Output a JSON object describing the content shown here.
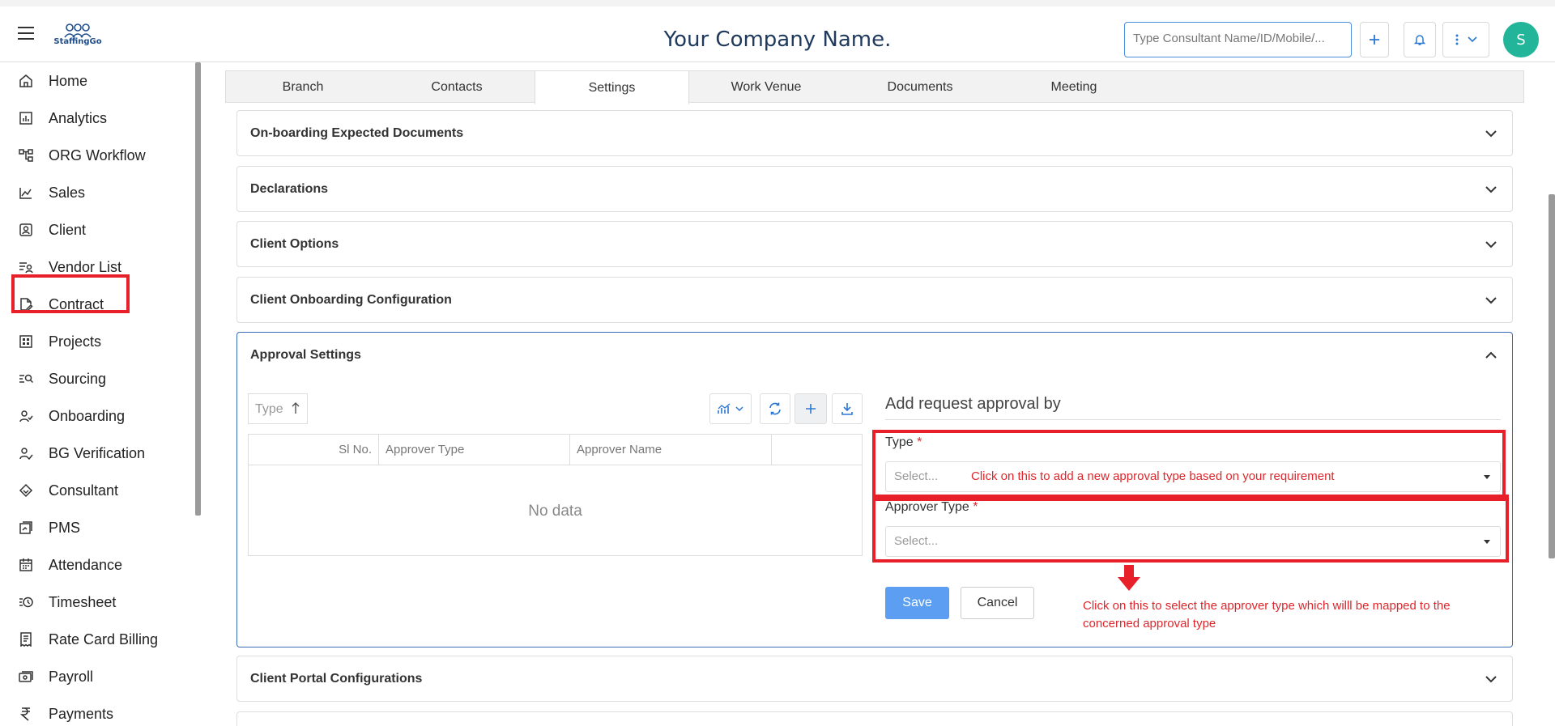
{
  "header": {
    "company_name": "Your Company Name.",
    "logo_text": "StaffingGo",
    "search_placeholder": "Type Consultant Name/ID/Mobile/...",
    "avatar_letter": "S"
  },
  "sidebar": {
    "items": [
      {
        "label": "Home",
        "icon": "home-icon"
      },
      {
        "label": "Analytics",
        "icon": "analytics-icon"
      },
      {
        "label": "ORG Workflow",
        "icon": "workflow-icon"
      },
      {
        "label": "Sales",
        "icon": "sales-icon"
      },
      {
        "label": "Client",
        "icon": "client-icon"
      },
      {
        "label": "Vendor List",
        "icon": "vendor-icon"
      },
      {
        "label": "Contract",
        "icon": "contract-icon"
      },
      {
        "label": "Projects",
        "icon": "projects-icon"
      },
      {
        "label": "Sourcing",
        "icon": "sourcing-icon"
      },
      {
        "label": "Onboarding",
        "icon": "onboarding-icon"
      },
      {
        "label": "BG Verification",
        "icon": "bg-verification-icon"
      },
      {
        "label": "Consultant",
        "icon": "consultant-icon"
      },
      {
        "label": "PMS",
        "icon": "pms-icon"
      },
      {
        "label": "Attendance",
        "icon": "attendance-icon"
      },
      {
        "label": "Timesheet",
        "icon": "timesheet-icon"
      },
      {
        "label": "Rate Card Billing",
        "icon": "rate-card-icon"
      },
      {
        "label": "Payroll",
        "icon": "payroll-icon"
      },
      {
        "label": "Payments",
        "icon": "rupee-icon"
      }
    ]
  },
  "tabs": [
    "Branch",
    "Contacts",
    "Settings",
    "Work Venue",
    "Documents",
    "Meeting"
  ],
  "active_tab": "Settings",
  "sections": {
    "s1": "On-boarding Expected Documents",
    "s2": "Declarations",
    "s3": "Client Options",
    "s4": "Client Onboarding Configuration",
    "s5": "Approval Settings",
    "s6": "Client Portal Configurations"
  },
  "approval": {
    "sort_label": "Type",
    "columns": [
      "Sl No.",
      "Approver Type",
      "Approver Name",
      ""
    ],
    "no_data": "No data",
    "form_title": "Add request approval by",
    "type_label": "Type",
    "type_placeholder": "Select...",
    "approver_type_label": "Approver Type",
    "approver_type_placeholder": "Select...",
    "required_mark": "*",
    "save_label": "Save",
    "cancel_label": "Cancel"
  },
  "annotations": {
    "type_note": "Click on this to add a new approval type based on your requirement",
    "approver_note_line1": "Click on this to select the approver type which willl be mapped to the",
    "approver_note_line2": "concerned approval type"
  },
  "colors": {
    "highlight": "#e8202a",
    "primary": "#5b9ef2",
    "avatar": "#22b59a"
  }
}
